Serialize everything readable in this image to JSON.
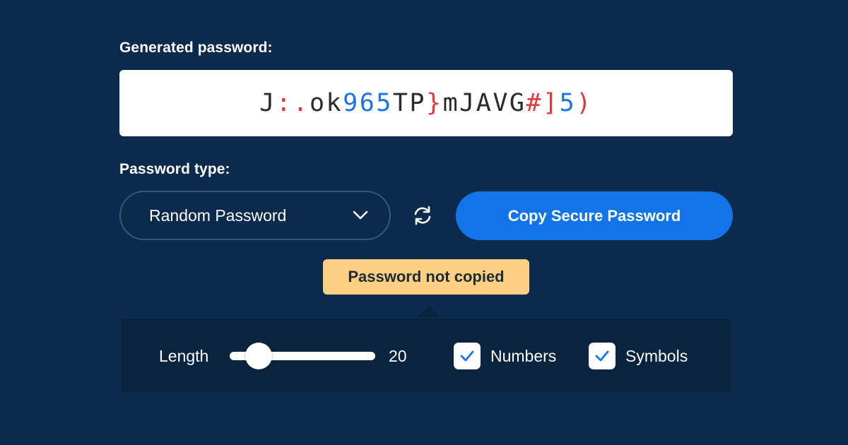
{
  "generated": {
    "label": "Generated password:",
    "password": "J:.ok965TP}mJAVG#]5)"
  },
  "type": {
    "label": "Password type:",
    "selected": "Random Password"
  },
  "copy_button_label": "Copy Secure Password",
  "toast_text": "Password not copied",
  "options": {
    "length_label": "Length",
    "length_value": "20",
    "length_fraction": 0.2,
    "numbers_label": "Numbers",
    "numbers_checked": true,
    "symbols_label": "Symbols",
    "symbols_checked": true
  },
  "icons": {
    "dropdown": "chevron-down-icon",
    "refresh": "refresh-icon",
    "check": "check-icon"
  },
  "colors": {
    "background": "#0c2a4c",
    "accent": "#1175e9",
    "toast": "#fcd080",
    "password_letters": "#2b2b2b",
    "password_numbers": "#1a73e8",
    "password_symbols": "#e03a3a"
  }
}
